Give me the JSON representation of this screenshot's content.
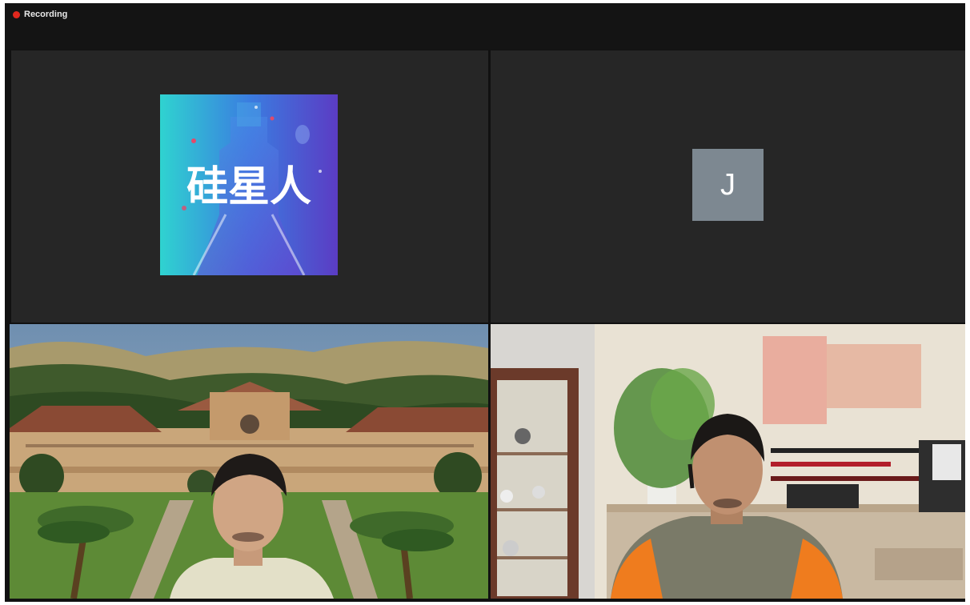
{
  "recording": {
    "label": "Recording",
    "dot_color": "#e0281e"
  },
  "participants": [
    {
      "kind": "logo",
      "logo_text": "硅星人",
      "logo_colors": [
        "#2fd3d0",
        "#3a7de0",
        "#5b3cc4"
      ]
    },
    {
      "kind": "avatar",
      "initial": "J",
      "avatar_color": "#7d8891"
    },
    {
      "kind": "video",
      "active_speaker": true,
      "highlight_color": "#c6d35a",
      "background": "campus-virtual-background"
    },
    {
      "kind": "video",
      "active_speaker": false,
      "background": "home-office"
    }
  ]
}
